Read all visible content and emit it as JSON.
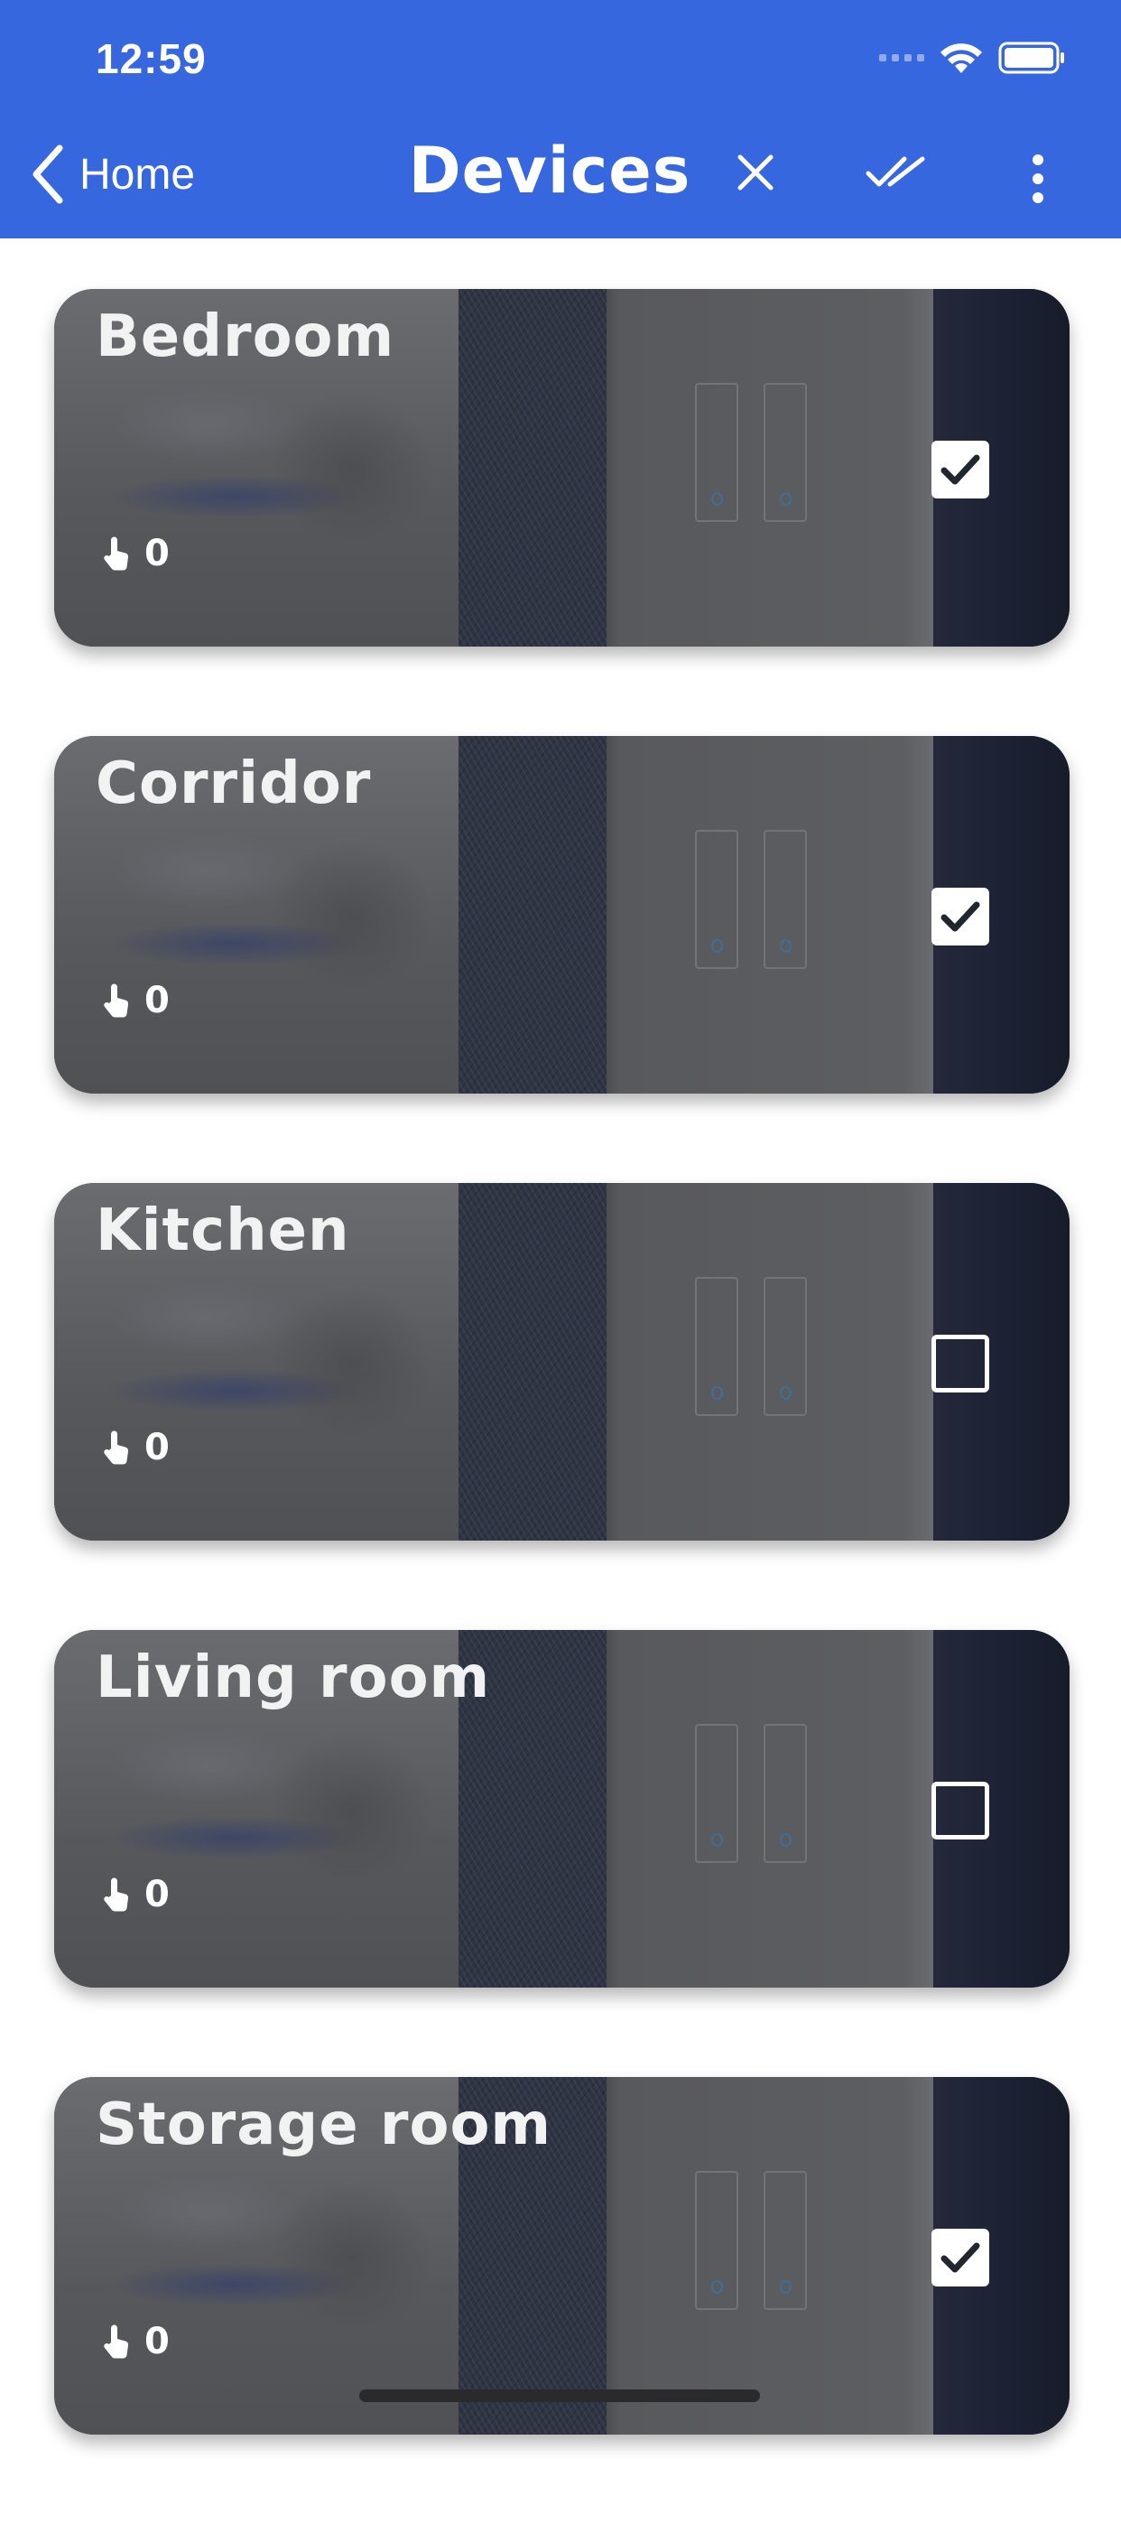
{
  "status_bar": {
    "time": "12:59",
    "icons": [
      "signal-icon",
      "wifi-icon",
      "battery-icon"
    ]
  },
  "nav": {
    "back_label": "Home",
    "title": "Devices",
    "actions": [
      "close-icon",
      "select-all-icon",
      "more-icon"
    ]
  },
  "colors": {
    "header": "#3767df",
    "text_on_header": "#ffffff"
  },
  "rooms": [
    {
      "name": "Bedroom",
      "count": "0",
      "checked": true
    },
    {
      "name": "Corridor",
      "count": "0",
      "checked": true
    },
    {
      "name": "Kitchen",
      "count": "0",
      "checked": false
    },
    {
      "name": "Living room",
      "count": "0",
      "checked": false
    },
    {
      "name": "Storage room",
      "count": "0",
      "checked": true
    }
  ]
}
